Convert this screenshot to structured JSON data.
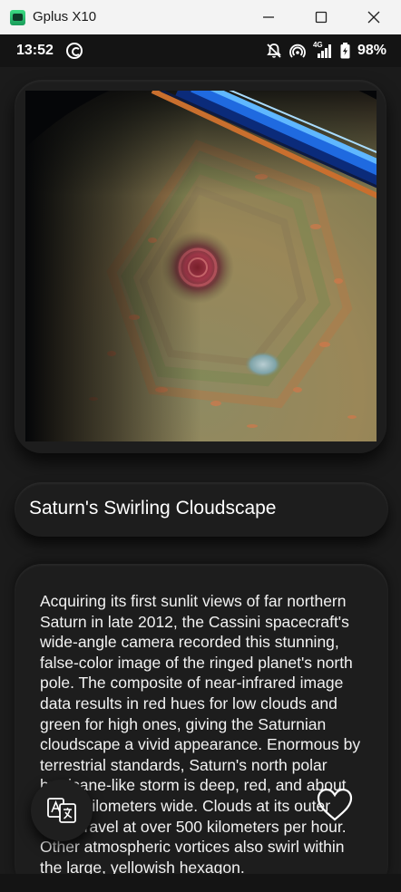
{
  "window": {
    "title": "Gplus X10"
  },
  "status_bar": {
    "time": "13:52",
    "network_label": "4G",
    "battery_percent": "98%"
  },
  "article": {
    "title": "Saturn's Swirling Cloudscape",
    "description": "Acquiring its first sunlit views of far northern Saturn in late 2012, the Cassini spacecraft's wide-angle camera recorded this stunning, false-color image of the ringed planet's north pole. The composite of near-infrared image data results in red hues for low clouds and green for high ones, giving the Saturnian cloudscape a vivid appearance. Enormous by terrestrial standards, Saturn's north polar hurricane-like storm is deep, red, and about 2,000 kilometers wide. Clouds at its outer edge travel at over 500 kilometers per hour. Other atmospheric vortices also swirl within the large, yellowish hexagon."
  },
  "icons": {
    "translate": "translate-icon",
    "favorite": "heart-outline-icon"
  },
  "colors": {
    "background": "#1b1b1b",
    "card": "#1d1d1d",
    "text": "#ffffff"
  }
}
